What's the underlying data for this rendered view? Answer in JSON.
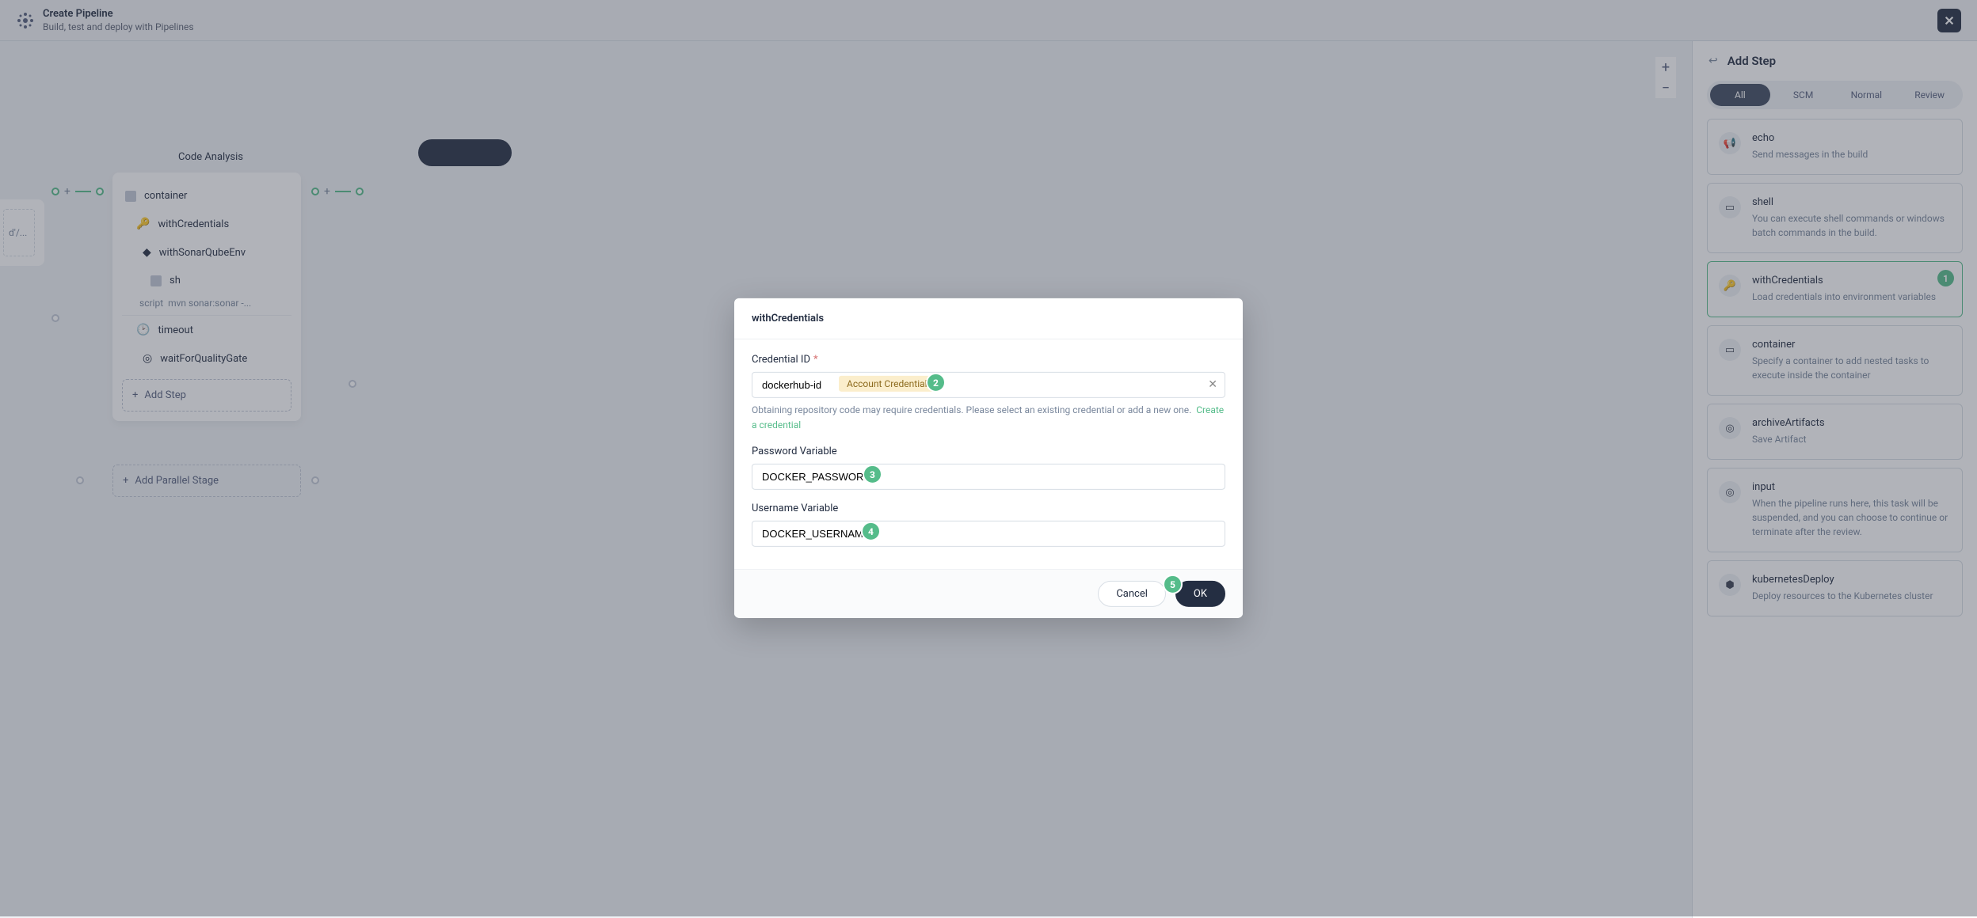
{
  "header": {
    "title": "Create Pipeline",
    "subtitle": "Build, test and deploy with Pipelines"
  },
  "canvas": {
    "stage_tab_main": "Code Analysis",
    "partial_script": "d'/...",
    "container_label": "container",
    "items": {
      "withCredentials": "withCredentials",
      "withSonarQubeEnv": "withSonarQubeEnv",
      "sh": "sh",
      "sh_script_label": "script",
      "sh_script_value": "mvn sonar:sonar -...",
      "timeout": "timeout",
      "waitForQualityGate": "waitForQualityGate"
    },
    "add_step": "Add Step",
    "add_parallel": "Add Parallel Stage"
  },
  "modal": {
    "title": "withCredentials",
    "cred_label": "Credential ID",
    "cred_value": "dockerhub-id",
    "cred_badge": "Account Credentials",
    "helper_text": "Obtaining repository code may require credentials. Please select an existing credential or add a new one.",
    "create_cred": "Create a credential",
    "password_label": "Password Variable",
    "password_value": "DOCKER_PASSWORD",
    "username_label": "Username Variable",
    "username_value": "DOCKER_USERNAME",
    "cancel": "Cancel",
    "ok": "OK"
  },
  "sidebar": {
    "title": "Add Step",
    "tabs": {
      "all": "All",
      "scm": "SCM",
      "normal": "Normal",
      "review": "Review"
    },
    "steps": [
      {
        "name": "echo",
        "desc": "Send messages in the build",
        "icon": "📢"
      },
      {
        "name": "shell",
        "desc": "You can execute shell commands or windows batch commands in the build.",
        "icon": "▭"
      },
      {
        "name": "withCredentials",
        "desc": "Load credentials into environment variables",
        "icon": "🔑",
        "selected": true,
        "marker": "1"
      },
      {
        "name": "container",
        "desc": "Specify a container to add nested tasks to execute inside the container",
        "icon": "▭"
      },
      {
        "name": "archiveArtifacts",
        "desc": "Save Artifact",
        "icon": "◎"
      },
      {
        "name": "input",
        "desc": "When the pipeline runs here, this task will be suspended, and you can choose to continue or terminate after the review.",
        "icon": "◎"
      },
      {
        "name": "kubernetesDeploy",
        "desc": "Deploy resources to the Kubernetes cluster",
        "icon": "⬢"
      }
    ]
  },
  "markers": {
    "m1": "1",
    "m2": "2",
    "m3": "3",
    "m4": "4",
    "m5": "5"
  }
}
